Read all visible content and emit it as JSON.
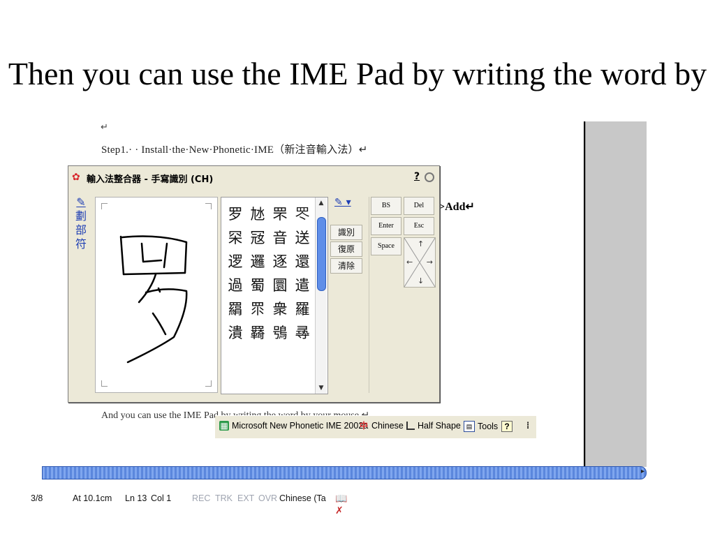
{
  "slide": {
    "title": "Then you can use the IME Pad by writing the word by your mouse."
  },
  "document": {
    "paragraph_mark": "↵",
    "step_line": "Step1.· · Install·the·New·Phonetic·IME（新注音輸入法）↵",
    "add_text": ">Add↵",
    "cut_line": "And you can use the IME Pad by writing the word by your mouse.↵"
  },
  "ime_pad": {
    "title": "輸入法整合器 - 手寫識別 (CH)",
    "help_label": "?",
    "side_tools": [
      "劃",
      "部",
      "符"
    ],
    "candidates": [
      "罗",
      "㝽",
      "罘",
      "罖",
      "罙",
      "㓂",
      "音",
      "送",
      "逻",
      "邏",
      "逐",
      "還",
      "過",
      "蜀",
      "圜",
      "遣",
      "羂",
      "眔",
      "衆",
      "羅",
      "潰",
      "羇",
      "鴞",
      "㝷"
    ],
    "buttons": {
      "recognize": "識別",
      "restore": "復原",
      "clear": "清除"
    },
    "keys": {
      "bs": "BS",
      "del": "Del",
      "enter": "Enter",
      "esc": "Esc",
      "space": "Space"
    }
  },
  "language_bar": {
    "ime_name": "Microsoft New Phonetic IME 2002a",
    "language": "Chinese",
    "shape": "Half Shape",
    "tools": "Tools",
    "help": "?",
    "more": "⁞"
  },
  "status_bar": {
    "page": "3/8",
    "at": "At 10.1cm",
    "ln": "Ln 13",
    "col": "Col 1",
    "rec": "REC",
    "trk": "TRK",
    "ext": "EXT",
    "ovr": "OVR",
    "lang": "Chinese (Ta"
  },
  "colors": {
    "accent_blue": "#1f3fb4",
    "scroll_blue": "#4f7dd8",
    "ime_bg": "#ece9d8",
    "gray_panel": "#c8c8c8"
  }
}
